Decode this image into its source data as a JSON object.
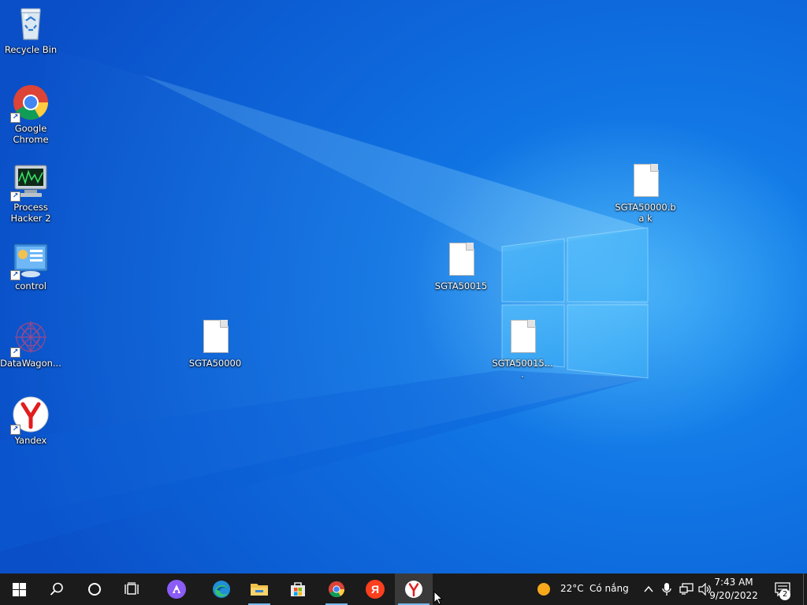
{
  "desktop": {
    "icons": [
      {
        "label": "Recycle Bin",
        "icon": "recycle-bin-icon"
      },
      {
        "label": "Google Chrome",
        "icon": "chrome-icon",
        "shortcut": true
      },
      {
        "label": "Process Hacker 2",
        "icon": "process-hacker-icon",
        "shortcut": true
      },
      {
        "label": "control",
        "icon": "control-panel-icon",
        "shortcut": true
      },
      {
        "label": "DataWagon...",
        "icon": "datawagon-icon",
        "shortcut": true
      },
      {
        "label": "Yandex",
        "icon": "yandex-browser-icon",
        "shortcut": true
      },
      {
        "label": "SGTA50000",
        "icon": "file-icon"
      },
      {
        "label": "SGTA50015",
        "icon": "file-icon"
      },
      {
        "label": "SGTA50015....",
        "icon": "file-icon"
      },
      {
        "label": "SGTA50000.ba k",
        "icon": "file-icon"
      }
    ]
  },
  "taskbar": {
    "buttons": [
      {
        "name": "start",
        "icon": "windows-logo-icon"
      },
      {
        "name": "search",
        "icon": "search-icon"
      },
      {
        "name": "cortana",
        "icon": "cortana-circle-icon"
      },
      {
        "name": "task-view",
        "icon": "task-view-icon"
      },
      {
        "name": "alice",
        "icon": "alice-icon"
      },
      {
        "name": "edge",
        "icon": "edge-icon"
      },
      {
        "name": "file-explorer",
        "icon": "folder-icon"
      },
      {
        "name": "store",
        "icon": "store-icon"
      },
      {
        "name": "chrome",
        "icon": "chrome-icon"
      },
      {
        "name": "yandex-app",
        "icon": "yandex-letter-icon"
      },
      {
        "name": "yandex-browser",
        "icon": "yandex-browser-icon"
      }
    ],
    "weather": {
      "temperature": "22°C",
      "condition": "Có nắng",
      "icon": "sun-icon"
    },
    "clock": {
      "time": "7:43 AM",
      "date": "9/20/2022"
    },
    "notifications": {
      "count": "2"
    },
    "colors": {
      "taskbar": "#1b1b1b",
      "accent": "#76b9ed",
      "desktop": "#0f6fe0"
    }
  }
}
